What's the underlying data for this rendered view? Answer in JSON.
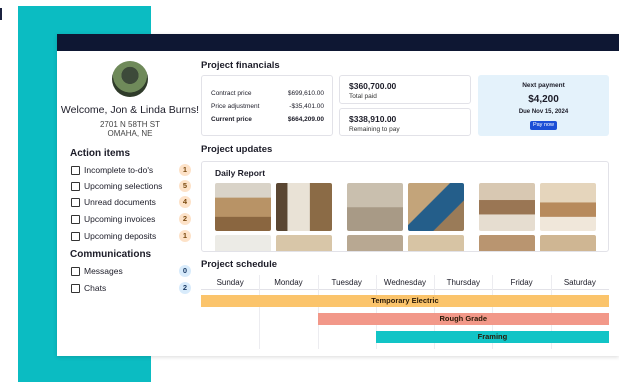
{
  "brand": {
    "teal": "#0bbcc2",
    "navy": "#0e1733",
    "button_blue": "#1b4fd6"
  },
  "sidebar": {
    "welcome": "Welcome, Jon & Linda Burns!",
    "address_line1": "2701 N 58TH ST",
    "address_line2": "OMAHA, NE",
    "action_items_title": "Action items",
    "action_items": [
      {
        "label": "Incomplete to-do's",
        "count": "1",
        "icon": "checklist-icon"
      },
      {
        "label": "Upcoming selections",
        "count": "5",
        "icon": "selection-icon"
      },
      {
        "label": "Unread documents",
        "count": "4",
        "icon": "document-icon"
      },
      {
        "label": "Upcoming invoices",
        "count": "2",
        "icon": "invoice-icon"
      },
      {
        "label": "Upcoming deposits",
        "count": "1",
        "icon": "deposit-icon"
      }
    ],
    "communications_title": "Communications",
    "communications": [
      {
        "label": "Messages",
        "count": "0",
        "icon": "message-icon"
      },
      {
        "label": "Chats",
        "count": "2",
        "icon": "chat-icon"
      }
    ]
  },
  "financials": {
    "title": "Project financials",
    "contract_price_label": "Contract price",
    "contract_price": "$699,610.00",
    "price_adjustment_label": "Price adjustment",
    "price_adjustment": "-$35,401.00",
    "current_price_label": "Current price",
    "current_price": "$664,209.00",
    "total_paid": "$360,700.00",
    "total_paid_label": "Total paid",
    "remaining": "$338,910.00",
    "remaining_label": "Remaining to pay",
    "next_payment_label": "Next payment",
    "next_payment_amount": "$4,200",
    "next_payment_due": "Due Nov 15, 2024",
    "pay_now": "Pay now"
  },
  "updates": {
    "title": "Project updates",
    "daily_report": "Daily Report"
  },
  "schedule": {
    "title": "Project schedule",
    "days": [
      "Sunday",
      "Monday",
      "Tuesday",
      "Wednesday",
      "Thursday",
      "Friday",
      "Saturday"
    ],
    "tasks": [
      {
        "name": "Temporary Electric",
        "color": "#fbc46b",
        "start_day": "Sunday",
        "end_day": "Saturday"
      },
      {
        "name": "Rough Grade",
        "color": "#f29889",
        "start_day": "Tuesday",
        "end_day": "Saturday"
      },
      {
        "name": "Framing",
        "color": "#12c4c6",
        "start_day": "Wednesday",
        "end_day": "Saturday"
      }
    ]
  }
}
